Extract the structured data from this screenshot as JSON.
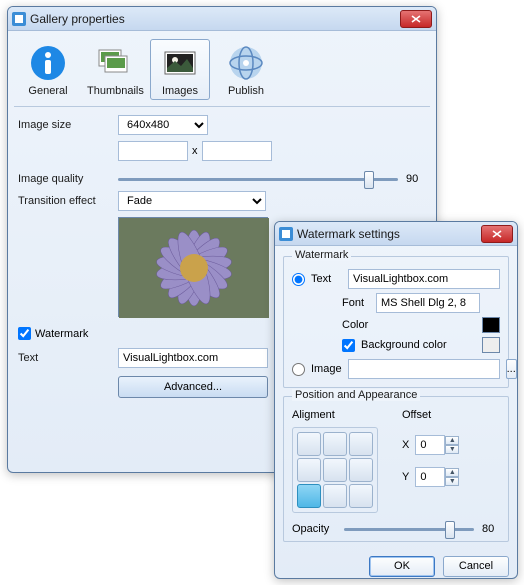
{
  "gallery": {
    "title": "Gallery properties",
    "tabs": {
      "general": "General",
      "thumbnails": "Thumbnails",
      "images": "Images",
      "publish": "Publish"
    },
    "imageSizeLabel": "Image size",
    "imageSizeValue": "640x480",
    "dimSeparator": "x",
    "imageQualityLabel": "Image quality",
    "imageQualityValue": "90",
    "transitionLabel": "Transition effect",
    "transitionValue": "Fade",
    "watermarkLabel": "Watermark",
    "textLabel": "Text",
    "textValue": "VisualLightbox.com",
    "advancedLabel": "Advanced..."
  },
  "wm": {
    "title": "Watermark settings",
    "groupWatermark": "Watermark",
    "radioText": "Text",
    "textValue": "VisualLightbox.com",
    "fontLabel": "Font",
    "fontValue": "MS Shell Dlg 2, 8",
    "colorLabel": "Color",
    "bgColorLabel": "Background color",
    "radioImage": "Image",
    "browseBtn": "...",
    "groupPos": "Position and Appearance",
    "alignmentLabel": "Aligment",
    "offsetLabel": "Offset",
    "xLabel": "X",
    "xValue": "0",
    "yLabel": "Y",
    "yValue": "0",
    "opacityLabel": "Opacity",
    "opacityValue": "80",
    "okLabel": "OK",
    "cancelLabel": "Cancel"
  }
}
